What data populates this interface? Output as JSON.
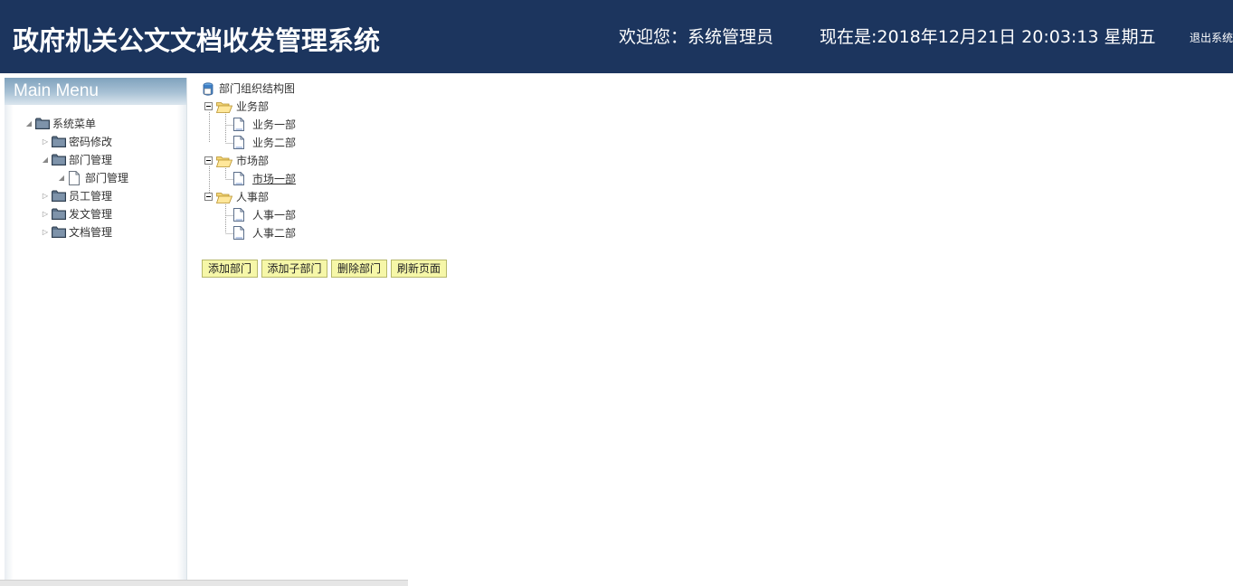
{
  "header": {
    "title": "政府机关公文文档收发管理系统",
    "welcome": "欢迎您：系统管理员",
    "datetime": "现在是:2018年12月21日 20:03:13 星期五",
    "logout": "退出系统",
    "bg_color": "#1c355e"
  },
  "sidebar": {
    "heading": "Main Menu",
    "root": {
      "label": "系统菜单",
      "icon": "folder-icon",
      "expanded": true
    },
    "items": [
      {
        "label": "密码修改",
        "icon": "folder-icon",
        "expanded": false
      },
      {
        "label": "部门管理",
        "icon": "folder-icon",
        "expanded": true
      },
      {
        "label": "部门管理",
        "icon": "document-icon",
        "child": true
      },
      {
        "label": "员工管理",
        "icon": "folder-icon",
        "expanded": false
      },
      {
        "label": "发文管理",
        "icon": "folder-icon",
        "expanded": false
      },
      {
        "label": "文档管理",
        "icon": "folder-icon",
        "expanded": false
      }
    ]
  },
  "tree": {
    "root_label": "部门组织结构图",
    "departments": [
      {
        "label": "业务部",
        "children": [
          "业务一部",
          "业务二部"
        ]
      },
      {
        "label": "市场部",
        "children": [
          "市场一部"
        ]
      },
      {
        "label": "人事部",
        "children": [
          "人事一部",
          "人事二部"
        ]
      }
    ],
    "highlighted": "市场一部"
  },
  "buttons": {
    "add_dept": "添加部门",
    "add_sub_dept": "添加子部门",
    "delete_dept": "删除部门",
    "refresh": "刷新页面",
    "bg_color": "#f6f7a8"
  }
}
